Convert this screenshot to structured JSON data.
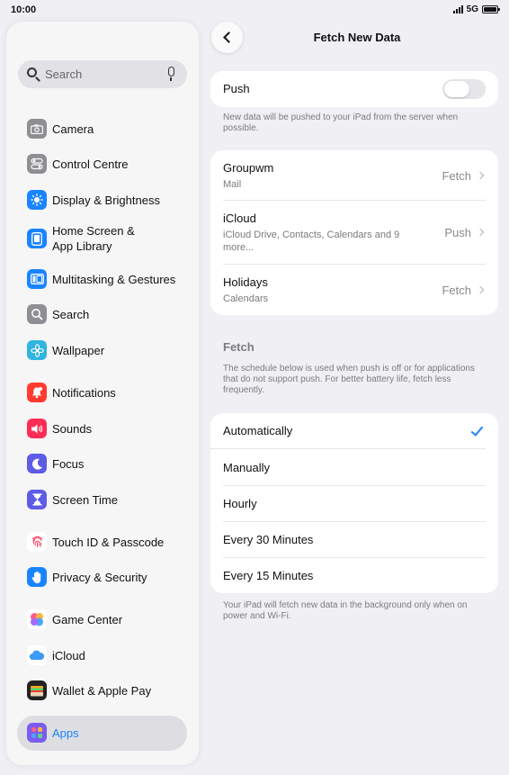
{
  "status": {
    "time": "10:00",
    "network": "5G"
  },
  "sidebar": {
    "search_placeholder": "Search",
    "items": [
      {
        "label": "Camera",
        "icon": "camera-icon",
        "color": "#8e8e93"
      },
      {
        "label": "Control Centre",
        "icon": "switches-icon",
        "color": "#8e8e93"
      },
      {
        "label": "Display & Brightness",
        "icon": "sun-icon",
        "color": "#1a84ff"
      },
      {
        "label": "Home Screen &\nApp Library",
        "icon": "home-screen-icon",
        "color": "#1a84ff"
      },
      {
        "label": "Multitasking & Gestures",
        "icon": "multitasking-icon",
        "color": "#1a84ff"
      },
      {
        "label": "Search",
        "icon": "search-icon",
        "color": "#8e8e93"
      },
      {
        "label": "Wallpaper",
        "icon": "flower-icon",
        "color": "#2fb5e0"
      },
      {
        "label": "Notifications",
        "icon": "bell-icon",
        "color": "#ff3b30"
      },
      {
        "label": "Sounds",
        "icon": "speaker-icon",
        "color": "#ff2d55"
      },
      {
        "label": "Focus",
        "icon": "moon-icon",
        "color": "#5e5ce6"
      },
      {
        "label": "Screen Time",
        "icon": "hourglass-icon",
        "color": "#5e5ce6"
      },
      {
        "label": "Touch ID & Passcode",
        "icon": "fingerprint-icon",
        "color": "#ffffff"
      },
      {
        "label": "Privacy & Security",
        "icon": "hand-icon",
        "color": "#1a84ff"
      },
      {
        "label": "Game Center",
        "icon": "game-center-icon",
        "color": "#ffffff"
      },
      {
        "label": "iCloud",
        "icon": "cloud-icon",
        "color": "#ffffff"
      },
      {
        "label": "Wallet & Apple Pay",
        "icon": "wallet-icon",
        "color": "#222222"
      },
      {
        "label": "Apps",
        "icon": "apps-grid-icon",
        "color": "#7b5cf0"
      }
    ]
  },
  "detail": {
    "title": "Fetch New Data",
    "push": {
      "label": "Push",
      "enabled": false,
      "note": "New data will be pushed to your iPad from the server when possible."
    },
    "accounts": [
      {
        "name": "Groupwm",
        "sub": "Mail",
        "value": "Fetch"
      },
      {
        "name": "iCloud",
        "sub": "iCloud Drive, Contacts, Calendars and 9 more...",
        "value": "Push"
      },
      {
        "name": "Holidays",
        "sub": "Calendars",
        "value": "Fetch"
      }
    ],
    "fetch_header": "Fetch",
    "fetch_note": "The schedule below is used when push is off or for applications that do not support push. For better battery life, fetch less frequently.",
    "schedule": [
      {
        "label": "Automatically",
        "selected": true
      },
      {
        "label": "Manually",
        "selected": false
      },
      {
        "label": "Hourly",
        "selected": false
      },
      {
        "label": "Every 30 Minutes",
        "selected": false
      },
      {
        "label": "Every 15 Minutes",
        "selected": false
      }
    ],
    "footer_note": "Your iPad will fetch new data in the background only when on power and Wi-Fi."
  },
  "colors": {
    "accent": "#1a84ff",
    "selected_text": "#1a84ff"
  }
}
